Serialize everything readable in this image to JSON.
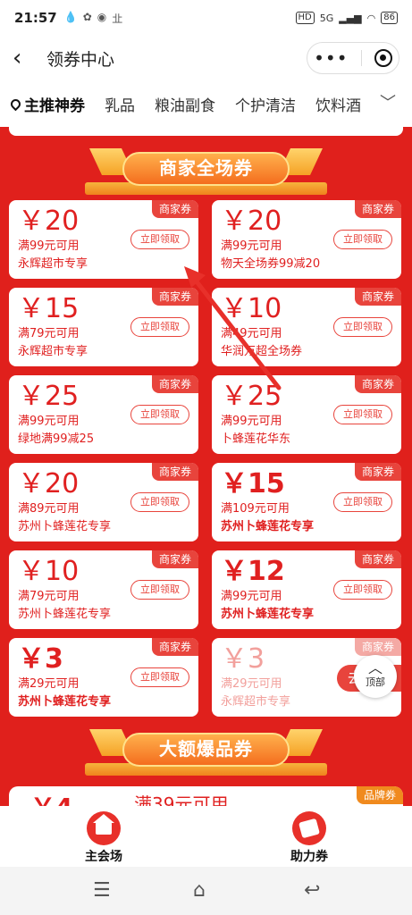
{
  "status": {
    "time": "21:57",
    "left_icons": [
      "💧",
      "✿",
      "◉",
      "㐀"
    ],
    "network": "5G",
    "battery": "86"
  },
  "nav": {
    "title": "领券中心",
    "back_icon": "chevron-left-icon",
    "more_icon": "more-dots-icon",
    "close_icon": "target-icon"
  },
  "tabs": {
    "items": [
      "主推神券",
      "乳品",
      "粮油副食",
      "个护清洁",
      "饮料酒"
    ],
    "active_index": 0,
    "more_icon": "chevron-down-icon"
  },
  "sections": {
    "merchant_title": "商家全场券",
    "big_title": "大额爆品券"
  },
  "coupons": [
    {
      "amount": "￥20",
      "condition": "满99元可用",
      "store": "永辉超市专享",
      "tag": "商家券",
      "button": "立即领取"
    },
    {
      "amount": "￥20",
      "condition": "满99元可用",
      "store": "物天全场券99减20",
      "tag": "商家券",
      "button": "立即领取"
    },
    {
      "amount": "￥15",
      "condition": "满79元可用",
      "store": "永辉超市专享",
      "tag": "商家券",
      "button": "立即领取"
    },
    {
      "amount": "￥10",
      "condition": "满49元可用",
      "store": "华润万超全场券",
      "tag": "商家券",
      "button": "立即领取"
    },
    {
      "amount": "￥25",
      "condition": "满99元可用",
      "store": "绿地满99减25",
      "tag": "商家券",
      "button": "立即领取"
    },
    {
      "amount": "￥25",
      "condition": "满99元可用",
      "store": "卜蜂莲花华东",
      "tag": "商家券",
      "button": "立即领取"
    },
    {
      "amount": "￥20",
      "condition": "满89元可用",
      "store": "苏州卜蜂莲花专享",
      "tag": "商家券",
      "button": "立即领取"
    },
    {
      "amount": "￥15",
      "condition": "满109元可用",
      "store": "苏州卜蜂莲花专享",
      "tag": "商家券",
      "button": "立即领取"
    },
    {
      "amount": "￥10",
      "condition": "满79元可用",
      "store": "苏州卜蜂莲花专享",
      "tag": "商家券",
      "button": "立即领取"
    },
    {
      "amount": "￥12",
      "condition": "满99元可用",
      "store": "苏州卜蜂莲花专享",
      "tag": "商家券",
      "button": "立即领取"
    },
    {
      "amount": "￥3",
      "condition": "满29元可用",
      "store": "苏州卜蜂莲花专享",
      "tag": "商家券",
      "button": "立即领取"
    },
    {
      "amount": "￥3",
      "condition": "满29元可用",
      "store": "永辉超市专享",
      "tag": "商家券",
      "button": "去使用"
    }
  ],
  "brand_preview": {
    "amount": "￥4",
    "condition": "满39元可用",
    "tag": "品牌券"
  },
  "top_button": {
    "label": "顶部"
  },
  "bottom_tabs": [
    {
      "label": "主会场",
      "icon": "home-icon"
    },
    {
      "label": "助力券",
      "icon": "ticket-icon"
    }
  ],
  "colors": {
    "primary_red": "#e0201c",
    "coupon_text": "#e02020",
    "banner_orange": "#f46d1e"
  }
}
